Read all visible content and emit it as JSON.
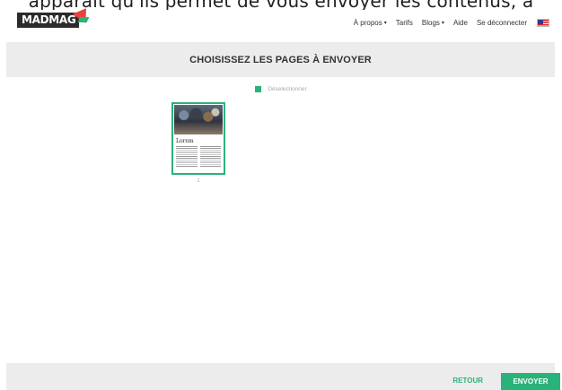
{
  "caption": "apparaît qu'ils permet de vous envoyer les contenus, à",
  "logo": {
    "text": "MADMAG",
    "icon": "flag-logo-icon"
  },
  "nav": {
    "items": [
      {
        "label": "À propos",
        "has_caret": true
      },
      {
        "label": "Tarifs",
        "has_caret": false
      },
      {
        "label": "Blogs",
        "has_caret": true
      },
      {
        "label": "Aide",
        "has_caret": false
      },
      {
        "label": "Se déconnecter",
        "has_caret": false
      }
    ],
    "language_icon": "us-flag-icon"
  },
  "header": {
    "title": "CHOISISSEZ LES PAGES À ENVOYER"
  },
  "selection": {
    "deselect_label": "Déselectionner"
  },
  "pages": [
    {
      "heading": "Lorem",
      "number": "1",
      "selected": true
    }
  ],
  "footer": {
    "back_label": "RETOUR",
    "send_label": "ENVOYER"
  },
  "colors": {
    "accent": "#2ab27b",
    "band": "#ececec",
    "logo_dark": "#2b2b2b",
    "logo_red": "#e8423a"
  }
}
